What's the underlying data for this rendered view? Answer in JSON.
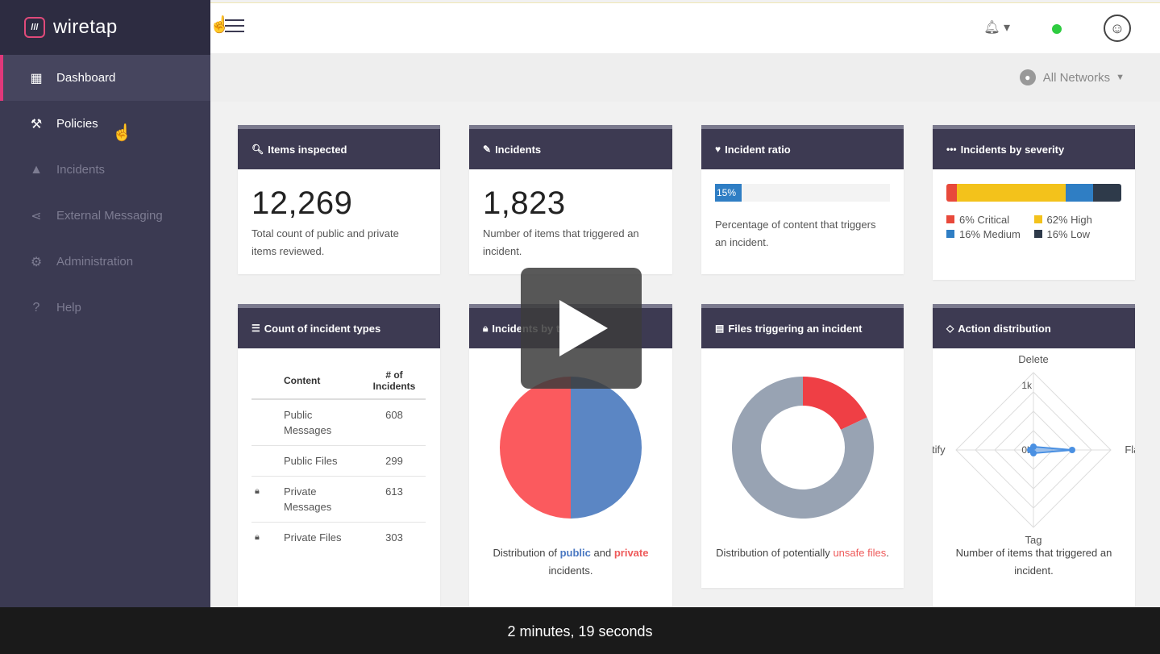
{
  "brand": {
    "logo": "///",
    "name": "wiretap"
  },
  "sidebar": {
    "items": [
      {
        "label": "Dashboard",
        "icon": "grid-icon"
      },
      {
        "label": "Policies",
        "icon": "gavel-icon"
      },
      {
        "label": "Incidents",
        "icon": "warning-icon"
      },
      {
        "label": "External Messaging",
        "icon": "share-icon"
      },
      {
        "label": "Administration",
        "icon": "gears-icon"
      },
      {
        "label": "Help",
        "icon": "help-icon"
      }
    ]
  },
  "topbar": {
    "status_color": "#2ecc40"
  },
  "subbar": {
    "network_label": "All Networks"
  },
  "cards": {
    "items_inspected": {
      "title": "Items inspected",
      "value": "12,269",
      "desc": "Total count of public and private items reviewed."
    },
    "incidents": {
      "title": "Incidents",
      "value": "1,823",
      "desc": "Number of items that triggered an incident."
    },
    "incident_ratio": {
      "title": "Incident ratio",
      "progress_label": "15%",
      "progress": 0.15,
      "desc": "Percentage of content that triggers an incident."
    },
    "severity": {
      "title": "Incidents by severity",
      "segments": [
        {
          "label": "6% Critical",
          "pct": 6,
          "color": "#e8493b"
        },
        {
          "label": "62% High",
          "pct": 62,
          "color": "#f3c21b"
        },
        {
          "label": "16% Medium",
          "pct": 16,
          "color": "#2f7ec4"
        },
        {
          "label": "16% Low",
          "pct": 16,
          "color": "#2e3a4a"
        }
      ]
    },
    "incident_types": {
      "title": "Count of incident types",
      "col_content": "Content",
      "col_count": "# of Incidents",
      "rows": [
        {
          "label": "Public Messages",
          "count": "608",
          "type": "public",
          "locked": false
        },
        {
          "label": "Public Files",
          "count": "299",
          "type": "public",
          "locked": false
        },
        {
          "label": "Private Messages",
          "count": "613",
          "type": "private",
          "locked": true
        },
        {
          "label": "Private Files",
          "count": "303",
          "type": "private",
          "locked": true
        }
      ]
    },
    "incidents_by_type": {
      "title": "Incidents by",
      "title_tail": "type",
      "caption_pre": "Distribution of",
      "caption_public": "public",
      "caption_and": "and",
      "caption_private": "private",
      "caption_post": "incidents."
    },
    "files_triggering": {
      "title": "Files triggering an incident",
      "caption_pre": "Distribution of potentially",
      "caption_hl": "unsafe files",
      "caption_post": "."
    },
    "action_distribution": {
      "title": "Action distribution",
      "desc": "Number of items that triggered an incident."
    }
  },
  "video": {
    "duration_text": "2 minutes, 19 seconds"
  },
  "chart_data": [
    {
      "type": "pie",
      "categories": [
        "public",
        "private"
      ],
      "values": [
        50,
        50
      ],
      "colors": [
        "#5b86c4",
        "#fb5a5e"
      ]
    },
    {
      "type": "pie",
      "categories": [
        "unsafe files",
        "other"
      ],
      "values": [
        18,
        82
      ],
      "colors": [
        "#ef3f45",
        "#98a3b3"
      ],
      "donut": true
    },
    {
      "type": "radar",
      "axes": [
        "Delete",
        "Flag",
        "Tag",
        "Notify"
      ],
      "tick_labels": [
        "0k",
        "1k"
      ],
      "values": [
        0.05,
        0.6,
        0.05,
        0.05
      ],
      "max": 1.2
    }
  ]
}
